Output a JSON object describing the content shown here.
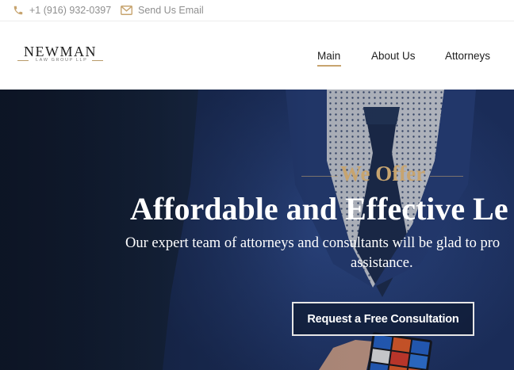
{
  "topbar": {
    "phone": "+1 (916) 932-0397",
    "email_label": "Send Us Email",
    "icon_color": "#c7a46f"
  },
  "logo": {
    "name": "NEWMAN",
    "sub": "LAW GROUP LLP"
  },
  "nav": {
    "items": [
      {
        "label": "Main",
        "active": true
      },
      {
        "label": "About Us",
        "active": false
      },
      {
        "label": "Attorneys",
        "active": false
      }
    ]
  },
  "hero": {
    "eyebrow": "We Offer",
    "headline": "Affordable and Effective Le",
    "subtext_line1": "Our expert team of attorneys and consultants will be glad to pro",
    "subtext_line2": "assistance.",
    "cta_label": "Request a Free Consultation",
    "accent": "#c7a46f"
  }
}
